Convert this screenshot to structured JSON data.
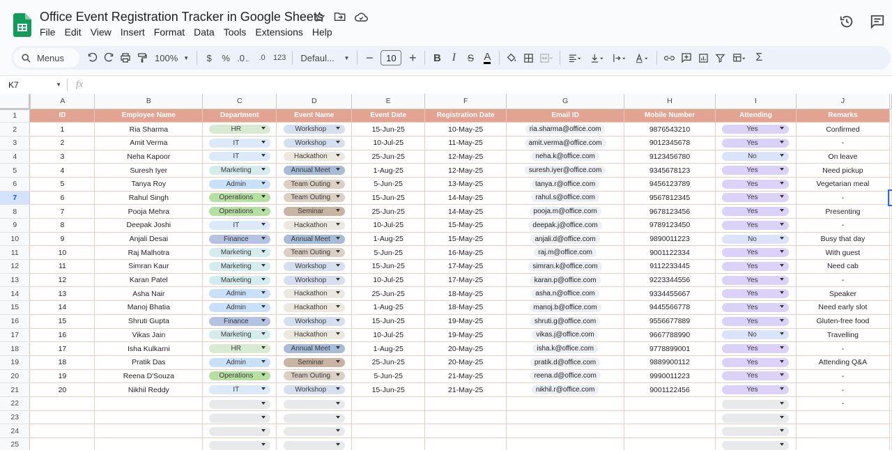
{
  "app": {
    "title": "Office Event Registration Tracker in Google Sheets",
    "menu": [
      "File",
      "Edit",
      "View",
      "Insert",
      "Format",
      "Data",
      "Tools",
      "Extensions",
      "Help"
    ],
    "title_icons": [
      "star-icon",
      "folder-move-icon",
      "cloud-status-icon"
    ],
    "right_icons": [
      "history-icon",
      "comment-icon"
    ]
  },
  "toolbar": {
    "menus_label": "Menus",
    "zoom": "100%",
    "currency": "$",
    "percent": "%",
    "decrease_decimal": ".0",
    "number_format": "123",
    "font": "Defaul...",
    "font_size": "10",
    "bold": "B",
    "italic": "I",
    "strike": "S",
    "text_color": "A"
  },
  "formula_bar": {
    "cell_ref": "K7",
    "fx": "fx",
    "value": ""
  },
  "columns": [
    "A",
    "B",
    "C",
    "D",
    "E",
    "F",
    "G",
    "H",
    "I",
    "J"
  ],
  "headers": [
    "ID",
    "Employee Name",
    "Department",
    "Event Name",
    "Event Date",
    "Registration Date",
    "Email ID",
    "Mobile Number",
    "Attending",
    "Remarks"
  ],
  "row_numbers": [
    "1",
    "2",
    "3",
    "4",
    "5",
    "6",
    "7",
    "8",
    "9",
    "10",
    "11",
    "12",
    "13",
    "14",
    "15",
    "16",
    "17",
    "18",
    "19",
    "20",
    "21",
    "22",
    "23",
    "24",
    "25"
  ],
  "colors": {
    "header_bg": "#e3a392",
    "dept": {
      "HR": "#d9ead3",
      "IT": "#dce9f8",
      "Marketing": "#d5ecee",
      "Admin": "#c9e1f8",
      "Operations": "#b6dfa3",
      "Finance": "#b3c3e1"
    },
    "event": {
      "Workshop": "#d6dfee",
      "Hackathon": "#ece8df",
      "Annual Meet": "#a7bcd6",
      "Team Outing": "#dcd0c4",
      "Seminar": "#c8b4a2"
    },
    "attending": {
      "Yes": "#dcd2f7",
      "No": "#dbe3f9"
    },
    "empty_chip": "#e8e9eb"
  },
  "rows": [
    {
      "id": "1",
      "name": "Ria Sharma",
      "dept": "HR",
      "event": "Workshop",
      "event_date": "15-Jun-25",
      "reg_date": "10-May-25",
      "email": "ria.sharma@office.com",
      "mobile": "9876543210",
      "attending": "Yes",
      "remarks": "Confirmed"
    },
    {
      "id": "2",
      "name": "Amit Verma",
      "dept": "IT",
      "event": "Workshop",
      "event_date": "10-Jul-25",
      "reg_date": "11-May-25",
      "email": "amit.verma@office.com",
      "mobile": "9012345678",
      "attending": "Yes",
      "remarks": "-"
    },
    {
      "id": "3",
      "name": "Neha Kapoor",
      "dept": "IT",
      "event": "Hackathon",
      "event_date": "25-Jun-25",
      "reg_date": "12-May-25",
      "email": "neha.k@office.com",
      "mobile": "9123456780",
      "attending": "No",
      "remarks": "On leave"
    },
    {
      "id": "4",
      "name": "Suresh Iyer",
      "dept": "Marketing",
      "event": "Annual Meet",
      "event_date": "1-Aug-25",
      "reg_date": "12-May-25",
      "email": "suresh.iyer@office.com",
      "mobile": "9345678123",
      "attending": "Yes",
      "remarks": "Need pickup"
    },
    {
      "id": "5",
      "name": "Tanya Roy",
      "dept": "Admin",
      "event": "Team Outing",
      "event_date": "5-Jun-25",
      "reg_date": "13-May-25",
      "email": "tanya.r@office.com",
      "mobile": "9456123789",
      "attending": "Yes",
      "remarks": "Vegetarian meal"
    },
    {
      "id": "6",
      "name": "Rahul Singh",
      "dept": "Operations",
      "event": "Team Outing",
      "event_date": "15-Jun-25",
      "reg_date": "14-May-25",
      "email": "rahul.s@office.com",
      "mobile": "9567812345",
      "attending": "Yes",
      "remarks": "-"
    },
    {
      "id": "7",
      "name": "Pooja Mehra",
      "dept": "Operations",
      "event": "Seminar",
      "event_date": "25-Jun-25",
      "reg_date": "14-May-25",
      "email": "pooja.m@office.com",
      "mobile": "9678123456",
      "attending": "Yes",
      "remarks": "Presenting"
    },
    {
      "id": "8",
      "name": "Deepak Joshi",
      "dept": "IT",
      "event": "Hackathon",
      "event_date": "10-Jul-25",
      "reg_date": "15-May-25",
      "email": "deepak.j@office.com",
      "mobile": "9789123450",
      "attending": "Yes",
      "remarks": "-"
    },
    {
      "id": "9",
      "name": "Anjali Desai",
      "dept": "Finance",
      "event": "Annual Meet",
      "event_date": "1-Aug-25",
      "reg_date": "15-May-25",
      "email": "anjali.d@office.com",
      "mobile": "9890011223",
      "attending": "No",
      "remarks": "Busy that day"
    },
    {
      "id": "10",
      "name": "Raj Malhotra",
      "dept": "Marketing",
      "event": "Team Outing",
      "event_date": "5-Jun-25",
      "reg_date": "16-May-25",
      "email": "raj.m@office.com",
      "mobile": "9001122334",
      "attending": "Yes",
      "remarks": "With guest"
    },
    {
      "id": "11",
      "name": "Simran Kaur",
      "dept": "Marketing",
      "event": "Workshop",
      "event_date": "15-Jun-25",
      "reg_date": "17-May-25",
      "email": "simran.k@office.com",
      "mobile": "9112233445",
      "attending": "Yes",
      "remarks": "Need cab"
    },
    {
      "id": "12",
      "name": "Karan Patel",
      "dept": "Marketing",
      "event": "Workshop",
      "event_date": "10-Jul-25",
      "reg_date": "17-May-25",
      "email": "karan.p@office.com",
      "mobile": "9223344556",
      "attending": "Yes",
      "remarks": "-"
    },
    {
      "id": "13",
      "name": "Asha Nair",
      "dept": "Admin",
      "event": "Hackathon",
      "event_date": "25-Jun-25",
      "reg_date": "18-May-25",
      "email": "asha.n@office.com",
      "mobile": "9334455667",
      "attending": "Yes",
      "remarks": "Speaker"
    },
    {
      "id": "14",
      "name": "Manoj Bhatia",
      "dept": "Admin",
      "event": "Hackathon",
      "event_date": "1-Aug-25",
      "reg_date": "18-May-25",
      "email": "manoj.b@office.com",
      "mobile": "9445566778",
      "attending": "Yes",
      "remarks": "Need early slot"
    },
    {
      "id": "15",
      "name": "Shruti Gupta",
      "dept": "Finance",
      "event": "Workshop",
      "event_date": "15-Jun-25",
      "reg_date": "19-May-25",
      "email": "shruti.g@office.com",
      "mobile": "9556677889",
      "attending": "Yes",
      "remarks": "Gluten-free food"
    },
    {
      "id": "16",
      "name": "Vikas Jain",
      "dept": "Marketing",
      "event": "Hackathon",
      "event_date": "10-Jul-25",
      "reg_date": "19-May-25",
      "email": "vikas.j@office.com",
      "mobile": "9667788990",
      "attending": "No",
      "remarks": "Travelling"
    },
    {
      "id": "17",
      "name": "Isha Kulkarni",
      "dept": "HR",
      "event": "Annual Meet",
      "event_date": "1-Aug-25",
      "reg_date": "20-May-25",
      "email": "isha.k@office.com",
      "mobile": "9778899001",
      "attending": "Yes",
      "remarks": "-"
    },
    {
      "id": "18",
      "name": "Pratik Das",
      "dept": "Admin",
      "event": "Seminar",
      "event_date": "25-Jun-25",
      "reg_date": "20-May-25",
      "email": "pratik.d@office.com",
      "mobile": "9889900112",
      "attending": "Yes",
      "remarks": "Attending Q&A"
    },
    {
      "id": "19",
      "name": "Reena D'Souza",
      "dept": "Operations",
      "event": "Team Outing",
      "event_date": "5-Jun-25",
      "reg_date": "21-May-25",
      "email": "reena.d@office.com",
      "mobile": "9990011223",
      "attending": "Yes",
      "remarks": "-"
    },
    {
      "id": "20",
      "name": "Nikhil Reddy",
      "dept": "IT",
      "event": "Workshop",
      "event_date": "15-Jun-25",
      "reg_date": "21-May-25",
      "email": "nikhil.r@office.com",
      "mobile": "9001122456",
      "attending": "Yes",
      "remarks": "-"
    }
  ],
  "empty_rows": [
    {
      "remarks": "-"
    },
    {
      "remarks": ""
    },
    {
      "remarks": ""
    },
    {
      "remarks": ""
    }
  ]
}
